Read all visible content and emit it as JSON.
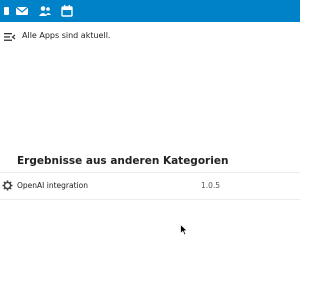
{
  "colors": {
    "header_background": "#0082c9",
    "icon_foreground": "#ffffff",
    "text": "#222222",
    "muted_text": "#555555"
  },
  "header": {
    "icons": [
      "files-icon",
      "mail-icon",
      "contacts-icon",
      "calendar-icon"
    ]
  },
  "status_message": "Alle Apps sind aktuell.",
  "other_results": {
    "heading": "Ergebnisse aus anderen Kategorien",
    "items": [
      {
        "icon": "gear-icon",
        "name": "OpenAI integration",
        "version": "1.0.5"
      }
    ]
  }
}
